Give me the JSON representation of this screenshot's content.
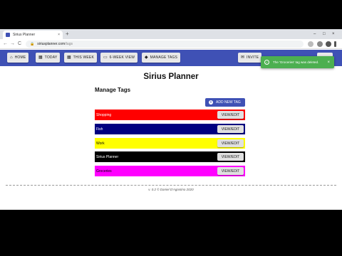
{
  "browser": {
    "tab_title": "Sirius Planner",
    "tab_close": "×",
    "new_tab": "+",
    "minimize": "–",
    "maximize": "□",
    "close": "×",
    "back": "←",
    "forward": "→",
    "reload": "C",
    "lock": "🔒",
    "url_host": "siriusplanner.com",
    "url_path": "/tags"
  },
  "nav": {
    "home": "HOME",
    "today": "TODAY",
    "this_week": "THIS WEEK",
    "six_week": "6-WEEK VIEW",
    "manage_tags": "MANAGE TAGS",
    "invite": "INVITE"
  },
  "toast": {
    "message": "The 'Groceries' tag was deleted.",
    "close": "×",
    "color": "#4caf50"
  },
  "page": {
    "title": "Sirius Planner",
    "heading": "Manage Tags",
    "add_button": "ADD NEW TAG"
  },
  "tags": [
    {
      "name": "Shopping",
      "bg": "#ff0000",
      "fg": "#ffffff",
      "action": "VIEW/EDIT"
    },
    {
      "name": "Fish",
      "bg": "#000080",
      "fg": "#ffffff",
      "action": "VIEW/EDIT"
    },
    {
      "name": "Work",
      "bg": "#ffff00",
      "fg": "#000000",
      "action": "VIEW/EDIT"
    },
    {
      "name": "Sirius Planner",
      "bg": "#000000",
      "fg": "#ffffff",
      "action": "VIEW/EDIT"
    },
    {
      "name": "Groceries",
      "bg": "#ff00ff",
      "fg": "#000000",
      "action": "VIEW/EDIT"
    }
  ],
  "footer": "v. 0.2 © Daniel D'Agostino 2020",
  "colors": {
    "primary": "#3f51b5"
  }
}
